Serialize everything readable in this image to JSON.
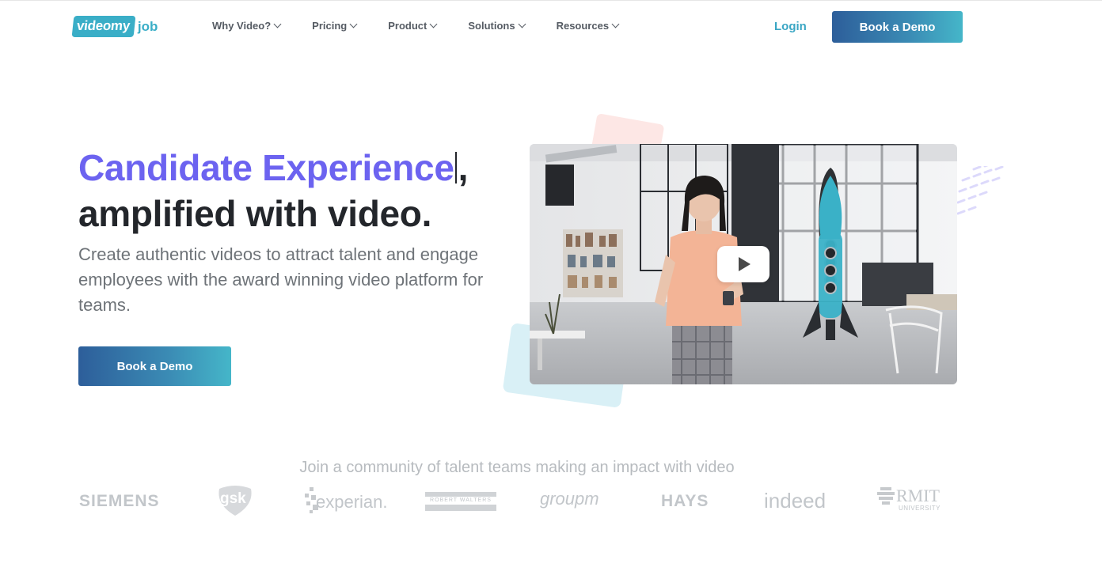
{
  "header": {
    "logo_badge": "videomy",
    "logo_suffix": "job",
    "nav": [
      {
        "label": "Why Video?"
      },
      {
        "label": "Pricing"
      },
      {
        "label": "Product"
      },
      {
        "label": "Solutions"
      },
      {
        "label": "Resources"
      }
    ],
    "login_label": "Login",
    "demo_label": "Book a Demo"
  },
  "hero": {
    "title_accent": "Candidate Experience",
    "title_comma": ",",
    "title_rest": "amplified with video.",
    "subtitle": "Create authentic videos to attract talent and engage employees with the award winning video platform for teams.",
    "demo_label": "Book a Demo"
  },
  "community": {
    "heading": "Join a community of talent teams making an impact with video",
    "logos": {
      "siemens": "SIEMENS",
      "gsk": "gsk",
      "experian": "experian.",
      "robert_walters": "ROBERT WALTERS",
      "groupm": "groupm",
      "hays": "HAYS",
      "indeed": "indeed",
      "rmit": "RMIT",
      "rmit_sub": "UNIVERSITY"
    }
  },
  "colors": {
    "accent": "#6c63f0",
    "brand_teal": "#3aaec7",
    "button_start": "#2d5e9a",
    "button_end": "#45b6c9"
  }
}
